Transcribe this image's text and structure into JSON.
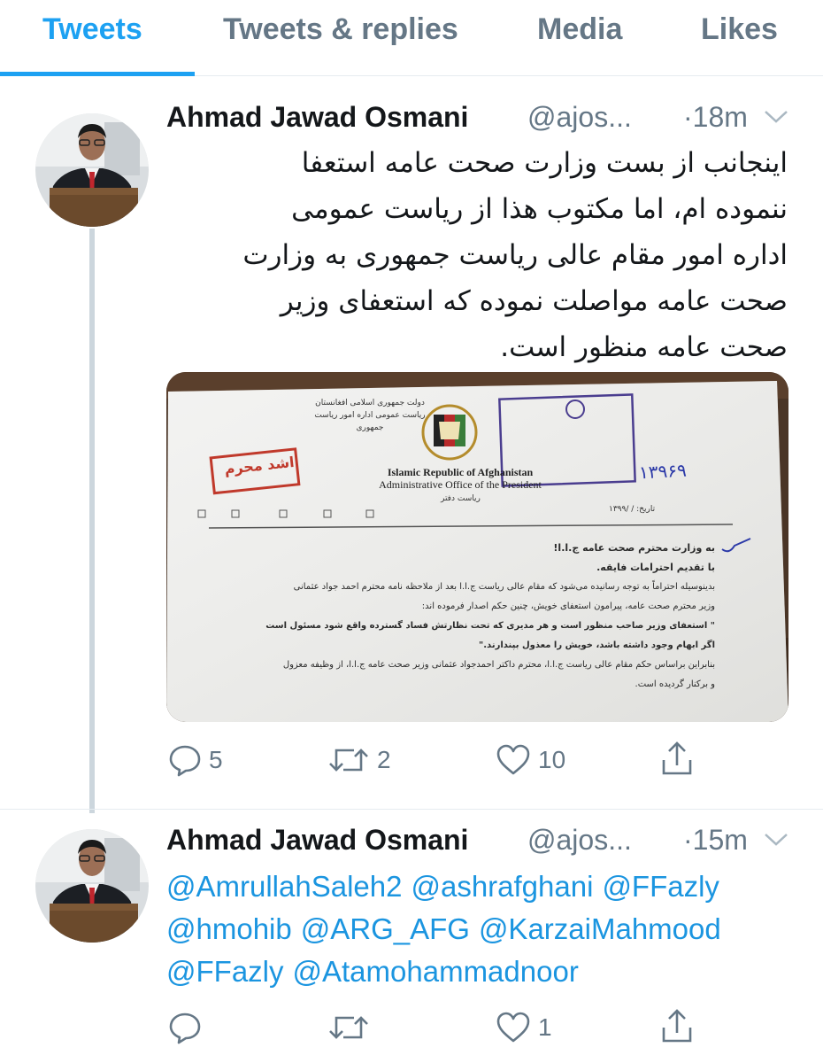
{
  "tabs": [
    "Tweets",
    "Tweets & replies",
    "Media",
    "Likes"
  ],
  "colors": {
    "accent": "#1da1f2",
    "link": "#1b95e0",
    "secondary": "#657786",
    "divider": "#e6ecf0"
  },
  "tweets": [
    {
      "name": "Ahmad Jawad Osmani",
      "handle": "@ajos...",
      "time": "·18m",
      "lines": [
        "اینجانب از بست وزارت صحت عامه استعفا",
        "ننموده ام، اما مکتوب هذا از ریاست عمومی",
        "اداره امور مقام عالی ریاست جمهوری به وزارت",
        "صحت عامه مواصلت نموده که استعفای وزیر",
        "صحت عامه منظور است."
      ],
      "image": {
        "header_right_1": "دولت جمهوری اسلامی افغانستان",
        "header_right_2": "ریاست عمومی اداره امور ریاست جمهوری",
        "stamp_secret": "اشد محرم",
        "en_title_1": "Islamic Republic of Afghanistan",
        "en_title_2": "Administrative Office of the President",
        "sub_office": "ریاست دفتر",
        "date_label": "تاریخ: / /۱۳۹۹",
        "addressee": "به وزارت محترم صحت عامه ج.ا.ا!",
        "greeting": "با تقدیم احترامات فایقه.",
        "body_1": "بدینوسیله احتراماً به توجه رسانیده می‌شود که مقام عالی ریاست ج.ا.ا بعد از ملاحظه نامه محترم احمد جواد عثمانی",
        "body_2": "وزیر محترم صحت عامه، پیرامون استعفای خویش، چنین حکم اصدار فرموده اند:",
        "quote_1": "\" استعفای وزیر صاحب منظور است و هر مدیری که تحت نظارتش فساد گسترده واقع شود مسئول است",
        "quote_2": "اگر ابهام وجود داشته باشد، خویش را معذول بپندارند.\"",
        "body_3": "بنابراین براساس حکم مقام عالی ریاست ج.ا.ا، محترم داکتر احمدجواد عثمانی وزیر صحت عامه ج.ا.ا، از وظیفه معزول",
        "body_4": "و برکنار گردیده است.",
        "reg_number": "۱۳۹۶۹"
      },
      "replies": "5",
      "retweets": "2",
      "likes": "10"
    },
    {
      "name": "Ahmad Jawad Osmani",
      "handle": "@ajos...",
      "time": "·15m",
      "mentions": [
        "@AmrullahSaleh2",
        "@ashrafghani",
        "@FFazly",
        "@hmohib",
        "@ARG_AFG",
        "@KarzaiMahmood",
        "@FFazly",
        "@Atamohammadnoor"
      ],
      "replies": "",
      "retweets": "",
      "likes": "1"
    }
  ]
}
